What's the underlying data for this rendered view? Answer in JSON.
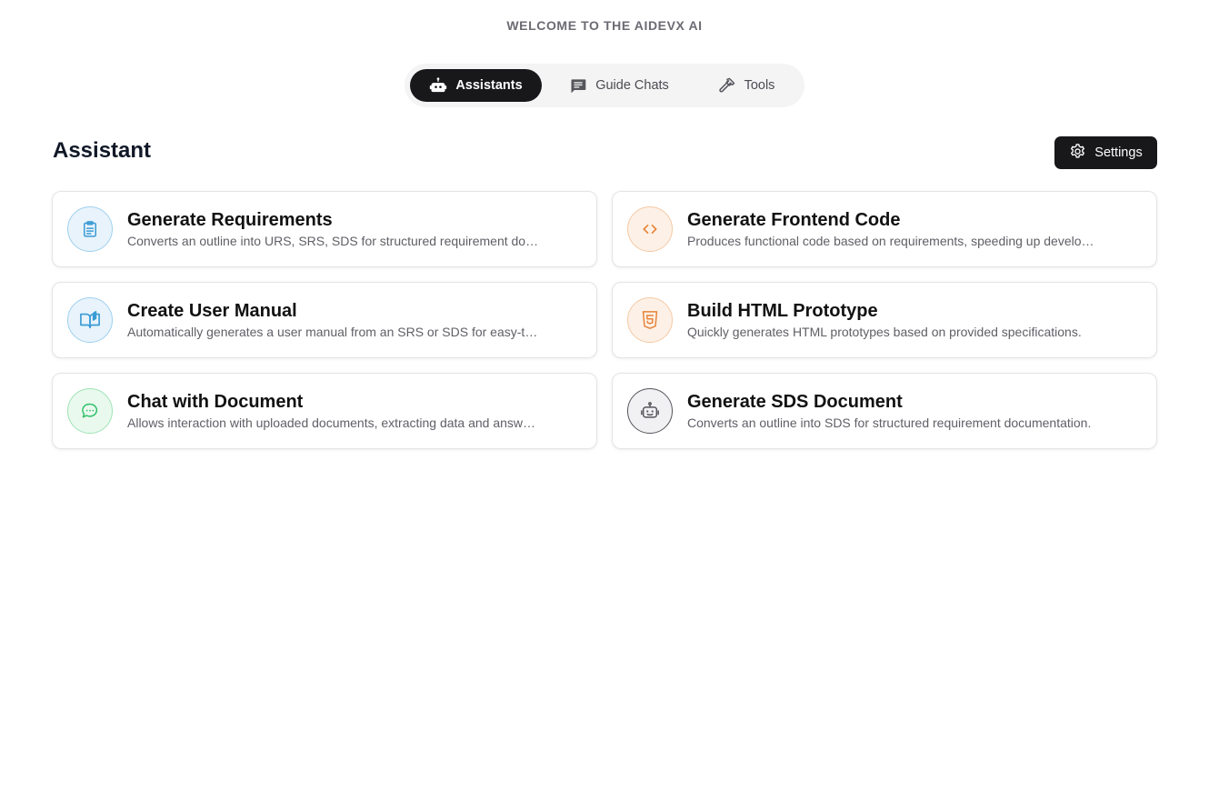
{
  "header": {
    "welcome": "WELCOME TO THE AIDEVX AI"
  },
  "tabs": [
    {
      "label": "Assistants",
      "icon": "robot-icon",
      "active": true
    },
    {
      "label": "Guide Chats",
      "icon": "chat-square-icon",
      "active": false
    },
    {
      "label": "Tools",
      "icon": "hammer-icon",
      "active": false
    }
  ],
  "section": {
    "title": "Assistant",
    "settings_label": "Settings"
  },
  "colors": {
    "accent_dark": "#18181b",
    "blue": "#3a9bd5",
    "orange": "#e8833a",
    "green": "#2fbf67",
    "gray": "#55555c"
  },
  "cards": [
    {
      "title": "Generate Requirements",
      "desc": "Converts an outline into URS, SRS, SDS for structured requirement documentation.",
      "icon": "clipboard-icon",
      "color": "blue"
    },
    {
      "title": "Generate Frontend Code",
      "desc": "Produces functional code based on requirements, speeding up development.",
      "icon": "code-icon",
      "color": "orange"
    },
    {
      "title": "Create User Manual",
      "desc": "Automatically generates a user manual from an SRS or SDS for easy-to-follow guidance.",
      "icon": "book-icon",
      "color": "blue"
    },
    {
      "title": "Build HTML Prototype",
      "desc": "Quickly generates HTML prototypes based on provided specifications.",
      "icon": "html5-icon",
      "color": "orange"
    },
    {
      "title": "Chat with Document",
      "desc": "Allows interaction with uploaded documents, extracting data and answering questions.",
      "icon": "chat-bubble-icon",
      "color": "green"
    },
    {
      "title": "Generate SDS Document",
      "desc": "Converts an outline into SDS for structured requirement documentation.",
      "icon": "robot-icon",
      "color": "gray"
    }
  ]
}
